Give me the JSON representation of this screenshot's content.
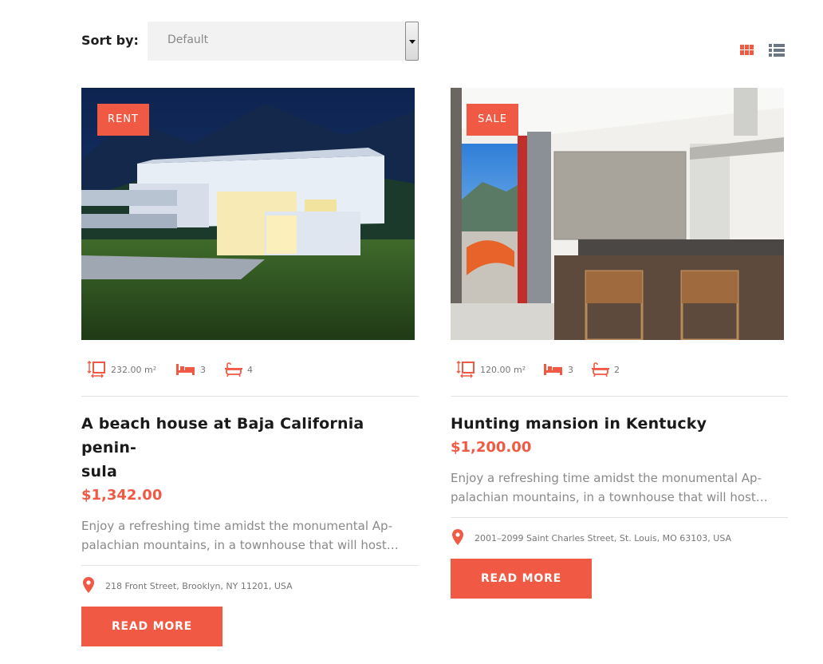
{
  "toolbar": {
    "sort_label": "Sort by:",
    "sort_value": "Default",
    "view_grid_icon": "grid-view-icon",
    "view_list_icon": "list-view-icon"
  },
  "colors": {
    "accent": "#f05a44",
    "muted": "#8a8a8a"
  },
  "listings": [
    {
      "badge": "RENT",
      "area": "232.00 m²",
      "bedrooms": "3",
      "bathrooms": "4",
      "title_line1": "A beach house at Baja California penin-",
      "title_line2": "sula",
      "price": "$1,342.00",
      "description": "Enjoy a refreshing time amidst the monumental Ap-palachian mountains, in a townhouse that will host…",
      "address": "218 Front Street, Brooklyn, NY 11201, USA",
      "button": "READ MORE"
    },
    {
      "badge": "SALE",
      "area": "120.00 m²",
      "bedrooms": "3",
      "bathrooms": "2",
      "title_line1": "Hunting mansion in Kentucky",
      "title_line2": "",
      "price": "$1,200.00",
      "description": "Enjoy a refreshing time amidst the monumental Ap-palachian mountains, in a townhouse that will host…",
      "address": "2001–2099 Saint Charles Street, St. Louis, MO 63103, USA",
      "button": "READ MORE"
    }
  ]
}
